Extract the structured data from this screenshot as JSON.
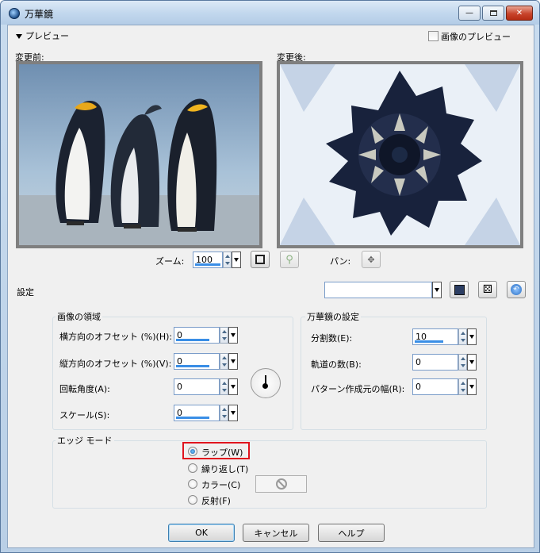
{
  "window": {
    "title": "万華鏡"
  },
  "preview": {
    "toggle_label": "プレビュー",
    "show_image_preview_label": "画像のプレビュー",
    "before_label": "変更前:",
    "after_label": "変更後:",
    "zoom_label": "ズーム:",
    "zoom_value": "100",
    "pan_label": "パン:"
  },
  "settings": {
    "label": "設定",
    "preset_value": ""
  },
  "image_region": {
    "title": "画像の領域",
    "h_offset_label": "横方向のオフセット (%)(H):",
    "h_offset_value": "0",
    "v_offset_label": "縦方向のオフセット (%)(V):",
    "v_offset_value": "0",
    "rotation_label": "回転角度(A):",
    "rotation_value": "0",
    "scale_label": "スケール(S):",
    "scale_value": "0"
  },
  "kaleidoscope": {
    "title": "万華鏡の設定",
    "divisions_label": "分割数(E):",
    "divisions_value": "10",
    "orbits_label": "軌道の数(B):",
    "orbits_value": "0",
    "pattern_width_label": "パターン作成元の幅(R):",
    "pattern_width_value": "0"
  },
  "edge_mode": {
    "title": "エッジ モード",
    "options": [
      {
        "label": "ラップ(W)",
        "selected": true
      },
      {
        "label": "繰り返し(T)",
        "selected": false
      },
      {
        "label": "カラー(C)",
        "selected": false
      },
      {
        "label": "反射(F)",
        "selected": false
      }
    ]
  },
  "buttons": {
    "ok": "OK",
    "cancel": "キャンセル",
    "help": "ヘルプ"
  },
  "colors": {
    "accent": "#3a8ee6",
    "highlight": "#e0141e"
  }
}
